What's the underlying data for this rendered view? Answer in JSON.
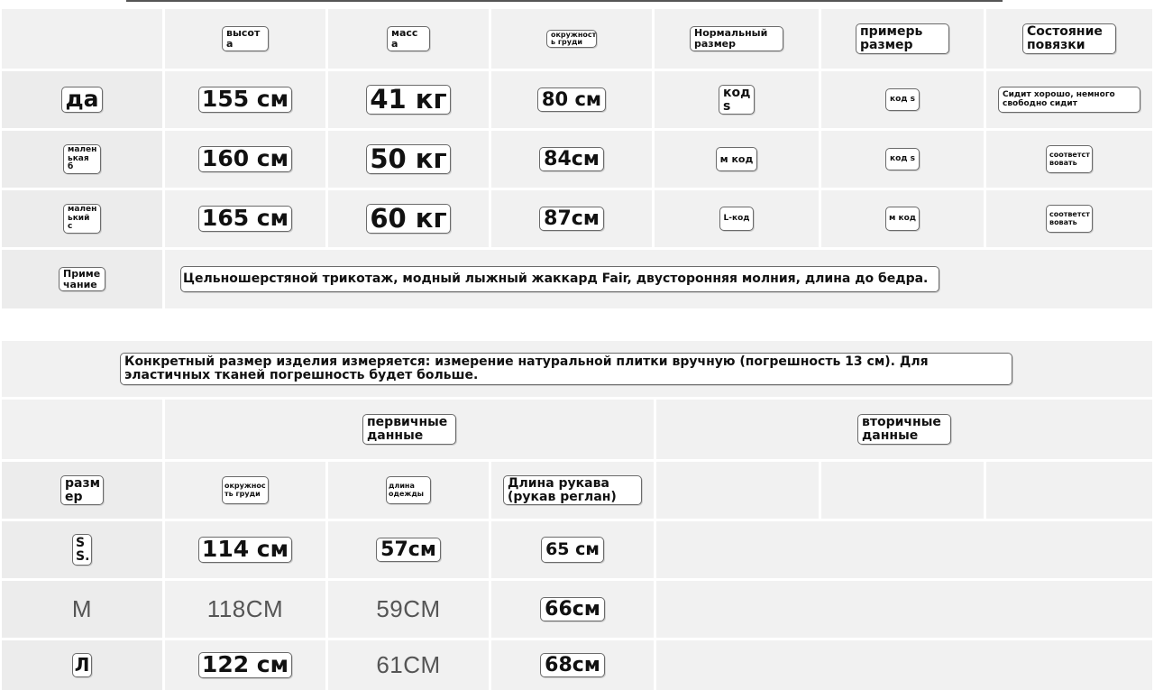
{
  "table1": {
    "headers": [
      "высот а",
      "масс а",
      "окружност ь груди",
      "Нормальный размер",
      "примерь размер",
      "Состояние повязки"
    ],
    "rows": [
      {
        "label": "да",
        "height": "155 см",
        "weight": "41 кг",
        "chest": "80 см",
        "normal_size": "код s",
        "try_size": "код s",
        "fit": "Сидит хорошо, немного свободно сидит"
      },
      {
        "label": "мален ькая б",
        "height": "160 см",
        "weight": "50 кг",
        "chest": "84см",
        "normal_size": "м код",
        "try_size": "код s",
        "fit": "соответст вовать"
      },
      {
        "label": "мален ький с",
        "height": "165 см",
        "weight": "60 кг",
        "chest": "87см",
        "normal_size": "L-код",
        "try_size": "м код",
        "fit": "соответст вовать"
      }
    ],
    "note_label": "Приме чание",
    "note_text": "Цельношерстяной трикотаж, модный лыжный жаккард Fair, двусторонняя молния, длина до бедра."
  },
  "table2": {
    "caption": "Конкретный размер изделия измеряется: измерение натуральной плитки вручную (погрешность 13 см). Для эластичных тканей погрешность будет больше.",
    "group_primary": "первичные данные",
    "group_secondary": "вторичные данные",
    "col_size": "разм ер",
    "col_chest": "окружнос ть груди",
    "col_length": "длина одежды",
    "col_sleeve": "Длина рукава (рукав реглан)",
    "rows": [
      {
        "size": "S S.",
        "chest": "114 см",
        "length": "57см",
        "sleeve": "65 см"
      },
      {
        "size": "M",
        "chest": "118CM",
        "length": "59CM",
        "sleeve": "66см"
      },
      {
        "size": "Л",
        "chest": "122 см",
        "length": "61CM",
        "sleeve": "68см"
      }
    ]
  }
}
